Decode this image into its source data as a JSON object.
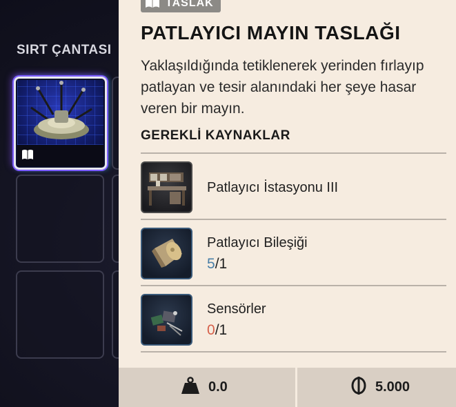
{
  "inventory": {
    "title": "SIRT ÇANTASI"
  },
  "tooltip": {
    "tag": {
      "label": "TASLAK",
      "icon": "book-icon"
    },
    "title": "PATLAYICI MAYIN TASLAĞI",
    "description": "Yaklaşıldığında tetiklenerek yerinden fırlayıp patlayan ve tesir alanındaki her şeye hasar veren bir mayın.",
    "resources_header": "GEREKLİ KAYNAKLAR",
    "resources": [
      {
        "name": "Patlayıcı İstasyonu III",
        "icon": "workbench-icon"
      },
      {
        "name": "Patlayıcı Bileşiği",
        "have": "5",
        "sep": "/",
        "need": "1",
        "icon": "explosive-compound-icon",
        "have_color": "#4a7fa8"
      },
      {
        "name": "Sensörler",
        "have": "0",
        "sep": "/",
        "need": "1",
        "icon": "sensors-icon",
        "have_color": "#d6604a"
      }
    ]
  },
  "footer": {
    "weight": "0.0",
    "weight_icon": "weight-icon",
    "price": "5.000",
    "price_icon": "coin-icon"
  }
}
